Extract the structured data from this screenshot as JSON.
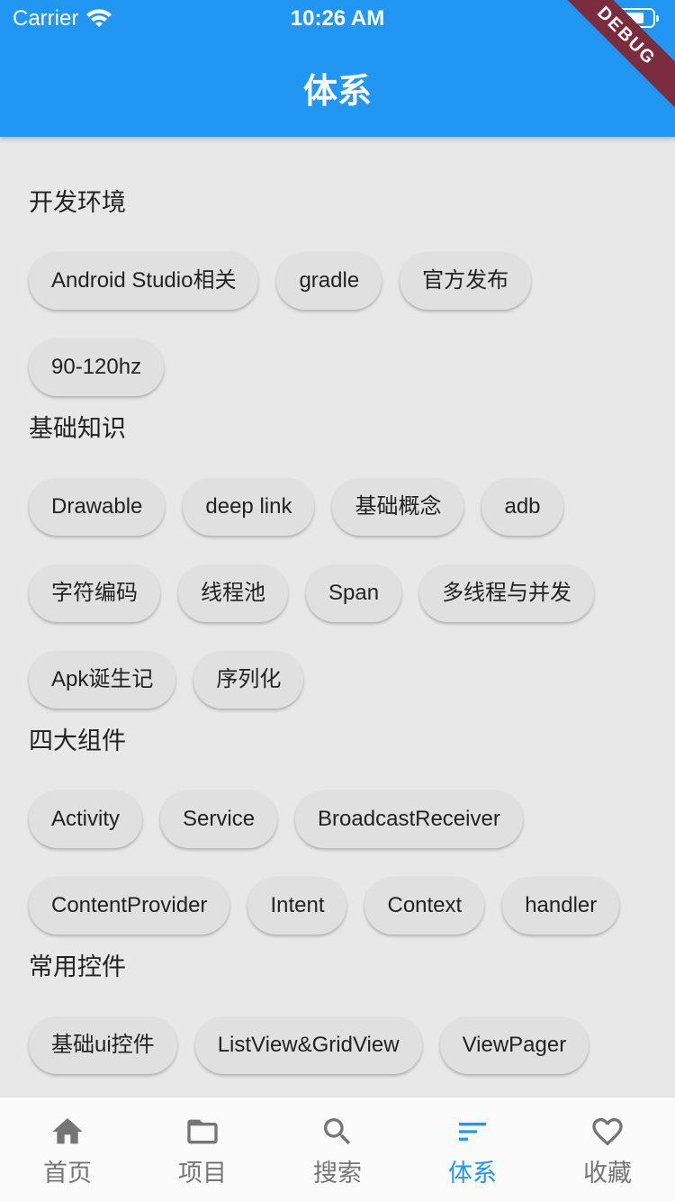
{
  "status": {
    "carrier": "Carrier",
    "time": "10:26 AM"
  },
  "appbar": {
    "title": "体系",
    "debug_banner": "DEBUG",
    "color": "#2196f3"
  },
  "sections": [
    {
      "title": "开发环境",
      "tags": [
        "Android Studio相关",
        "gradle",
        "官方发布",
        "90-120hz"
      ]
    },
    {
      "title": "基础知识",
      "tags": [
        "Drawable",
        "deep link",
        "基础概念",
        "adb",
        "字符编码",
        "线程池",
        "Span",
        "多线程与并发",
        "Apk诞生记",
        "序列化"
      ]
    },
    {
      "title": "四大组件",
      "tags": [
        "Activity",
        "Service",
        "BroadcastReceiver",
        "ContentProvider",
        "Intent",
        "Context",
        "handler"
      ]
    },
    {
      "title": "常用控件",
      "tags": [
        "基础ui控件",
        "ListView&GridView",
        "ViewPager"
      ]
    }
  ],
  "bottom_nav": {
    "items": [
      {
        "label": "首页",
        "icon": "home-icon"
      },
      {
        "label": "项目",
        "icon": "folder-icon"
      },
      {
        "label": "搜索",
        "icon": "search-icon"
      },
      {
        "label": "体系",
        "icon": "sort-icon",
        "active": true
      },
      {
        "label": "收藏",
        "icon": "heart-icon"
      }
    ],
    "active_color": "#2196f3"
  }
}
